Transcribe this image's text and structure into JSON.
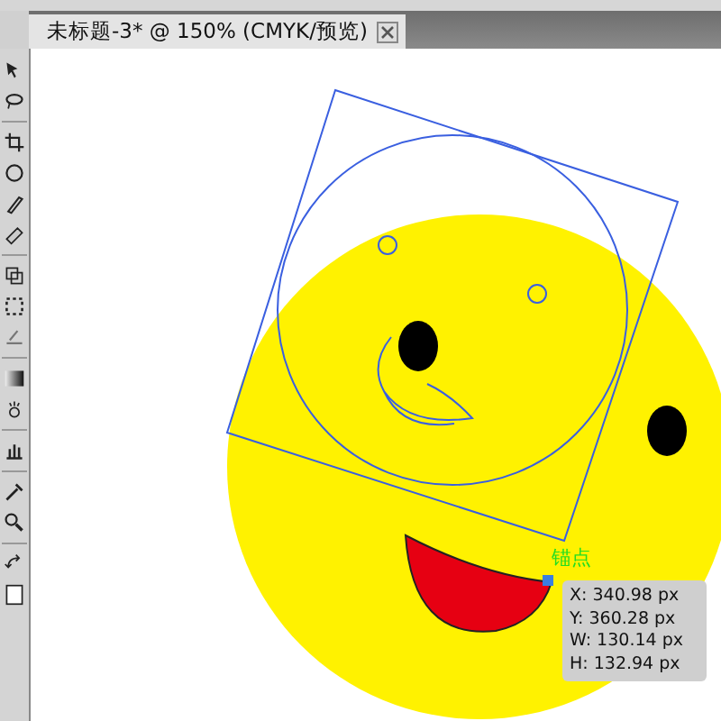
{
  "document_tab": {
    "title": "未标题-3* @ 150% (CMYK/预览)"
  },
  "canvas": {
    "anchor_label": "锚点",
    "info_tooltip": [
      "X: 340.98 px",
      "Y: 360.28 px",
      "W: 130.14 px",
      "H: 132.94 px"
    ]
  }
}
